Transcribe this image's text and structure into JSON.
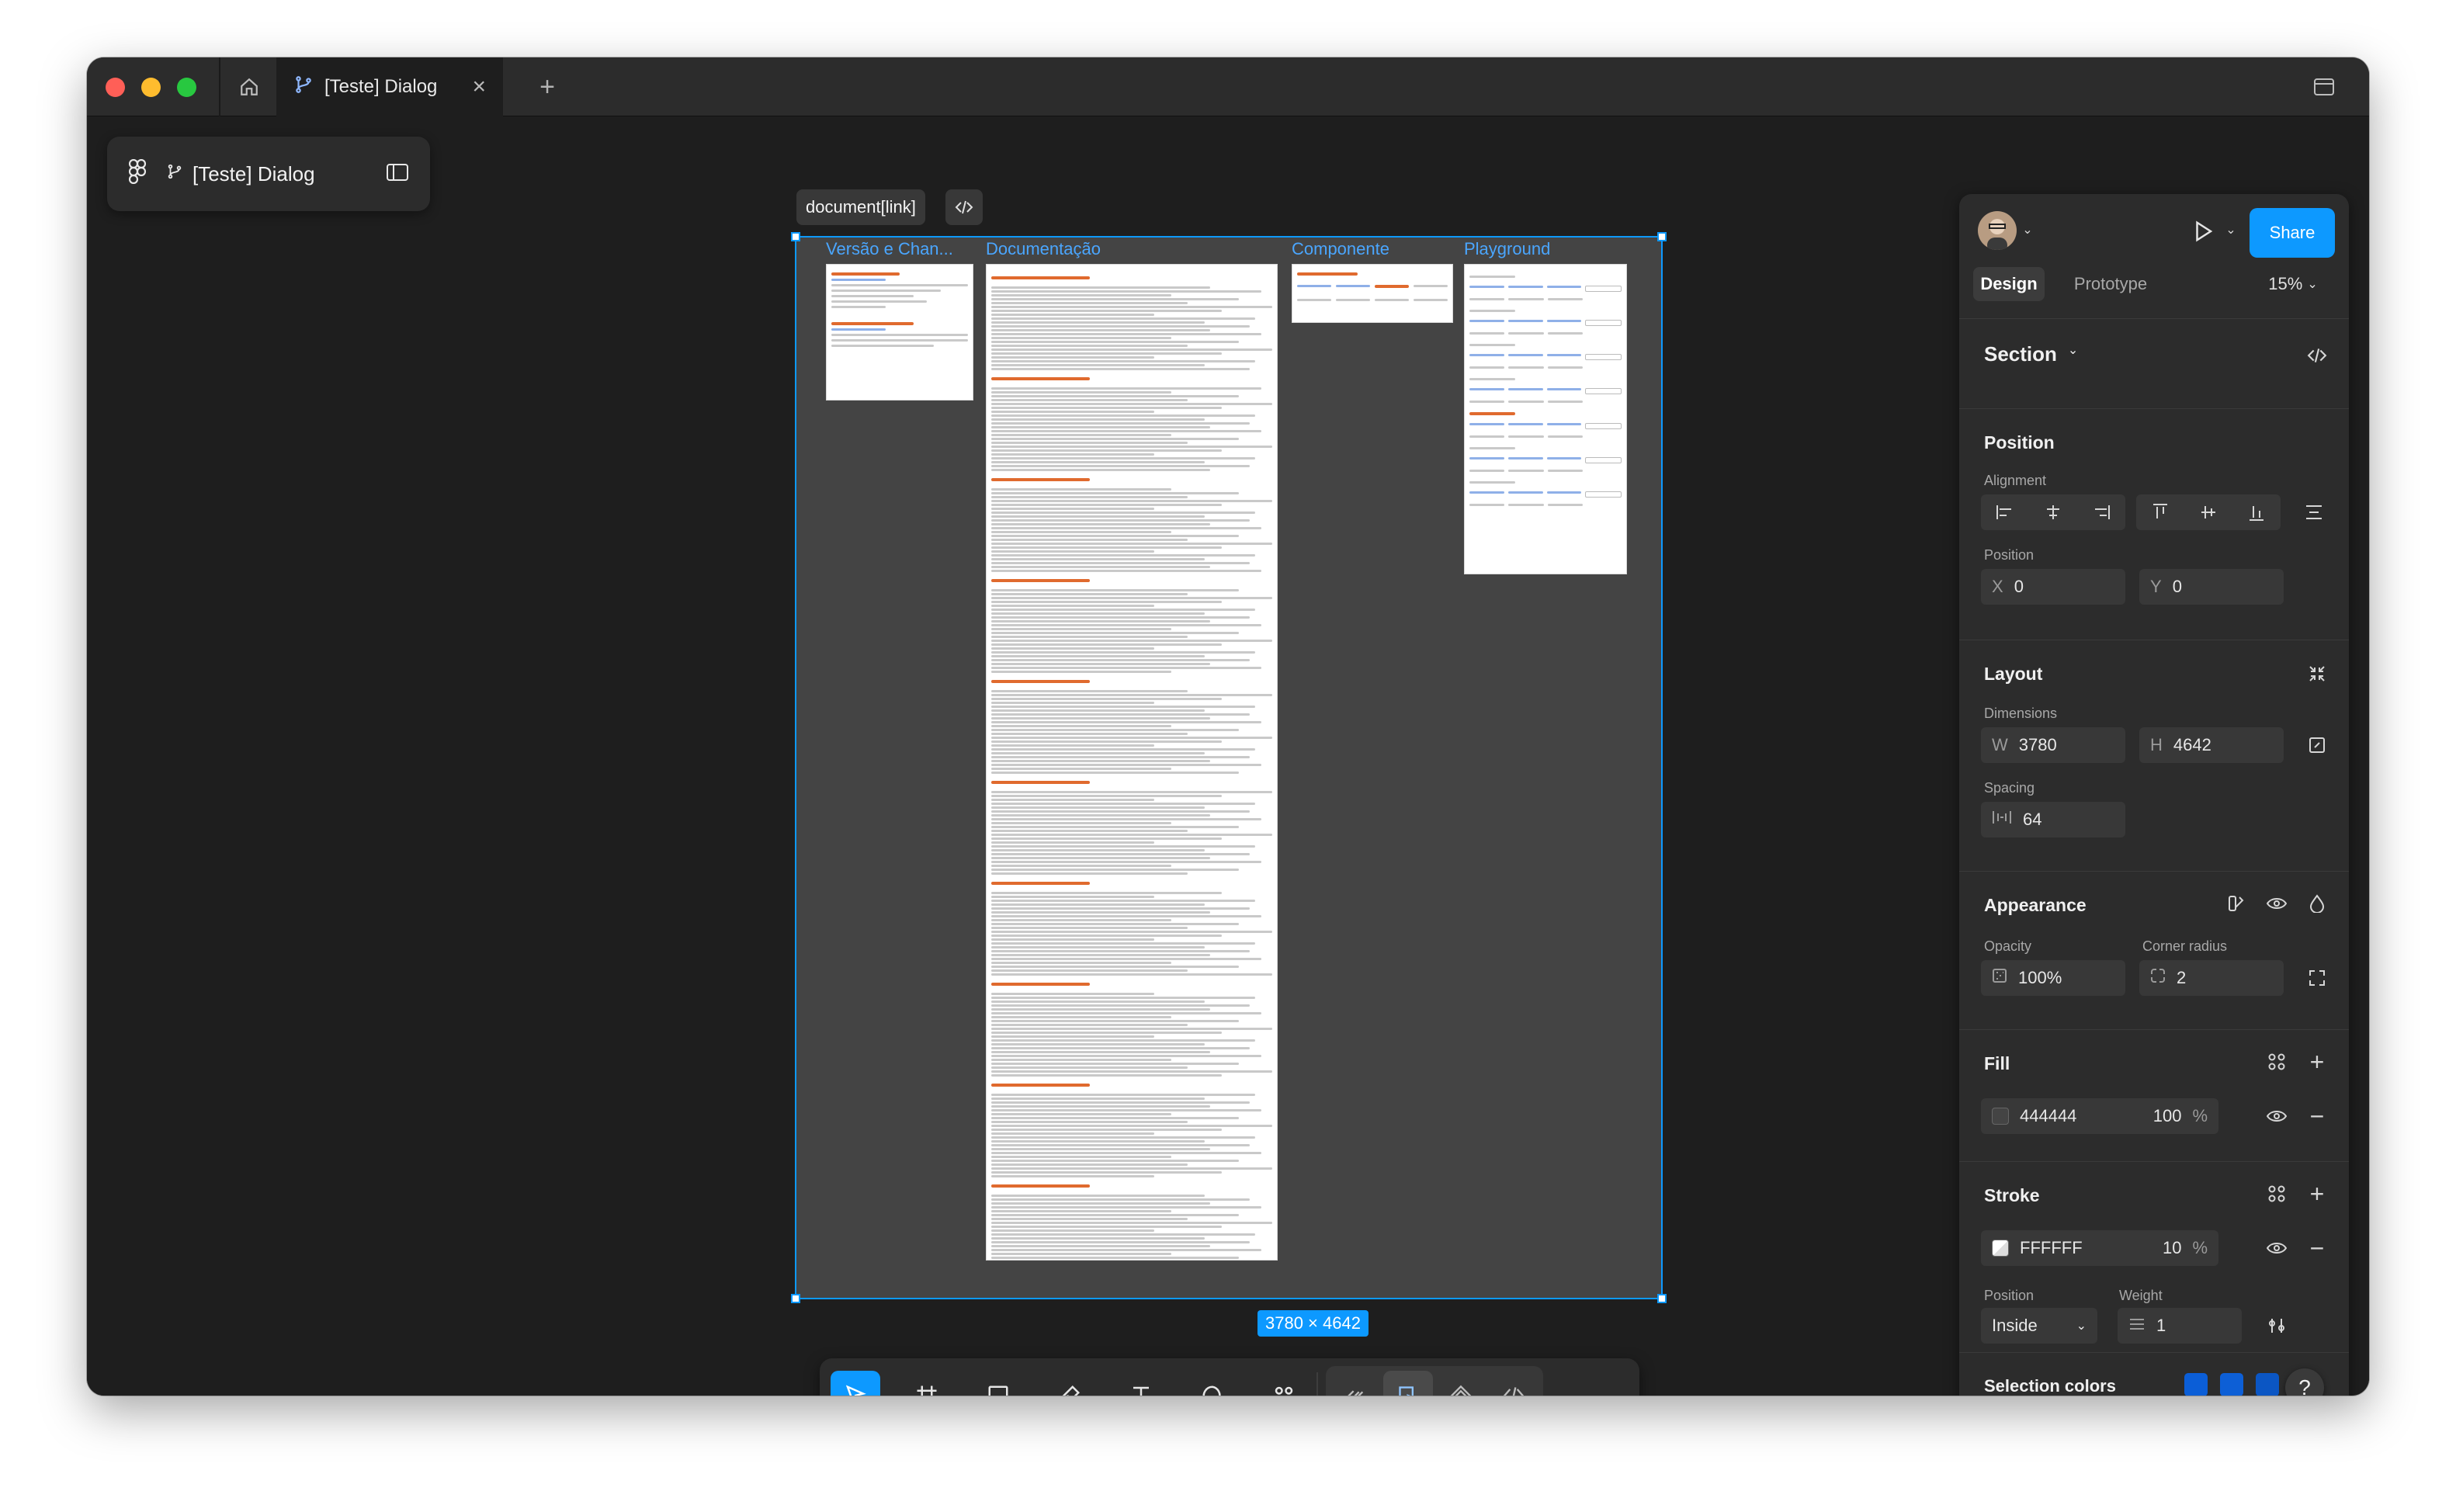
{
  "window": {
    "tab_title": "[Teste] Dialog"
  },
  "file": {
    "name": "[Teste] Dialog"
  },
  "canvas": {
    "selection_label": "document[link]",
    "size_badge": "3780 × 4642",
    "frames": [
      {
        "title": "Versão e Chan..."
      },
      {
        "title": "Documentação"
      },
      {
        "title": "Componente"
      },
      {
        "title": "Playground"
      }
    ]
  },
  "panel": {
    "share_label": "Share",
    "tabs": {
      "design": "Design",
      "prototype": "Prototype"
    },
    "zoom": "15%",
    "section_label": "Section",
    "position": {
      "title": "Position",
      "alignment_label": "Alignment",
      "position_label": "Position",
      "x_prefix": "X",
      "x": "0",
      "y_prefix": "Y",
      "y": "0"
    },
    "layout": {
      "title": "Layout",
      "dimensions_label": "Dimensions",
      "w_prefix": "W",
      "w": "3780",
      "h_prefix": "H",
      "h": "4642",
      "spacing_label": "Spacing",
      "spacing": "64"
    },
    "appearance": {
      "title": "Appearance",
      "opacity_label": "Opacity",
      "opacity": "100%",
      "radius_label": "Corner radius",
      "radius": "2"
    },
    "fill": {
      "title": "Fill",
      "color": "444444",
      "opacity": "100",
      "unit": "%",
      "swatch": "#444444"
    },
    "stroke": {
      "title": "Stroke",
      "color": "FFFFFF",
      "opacity": "10",
      "unit": "%",
      "position_label": "Position",
      "position": "Inside",
      "weight_label": "Weight",
      "weight": "1"
    },
    "selection_colors": {
      "title": "Selection colors",
      "colors": [
        "#0b5ed7",
        "#0d5fd6",
        "#0b56c4"
      ]
    }
  },
  "colors": {
    "accent": "#0d99ff",
    "traffic_red": "#ff5f57",
    "traffic_yellow": "#febc2e",
    "traffic_green": "#28c840"
  }
}
